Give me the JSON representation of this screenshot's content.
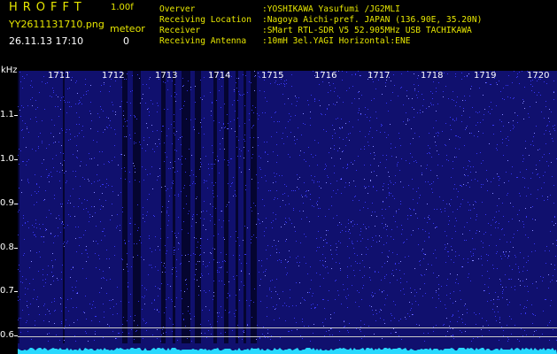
{
  "header": {
    "app_name": "HROFFT",
    "version": "1.00f",
    "file_name": "YY2611131710.png",
    "timestamp": "26.11.13 17:10",
    "meteor_label": "meteor",
    "meteor_count": "0"
  },
  "info": [
    {
      "label": "Overver",
      "value": ":YOSHIKAWA Yasufumi /JG2MLI"
    },
    {
      "label": "Receiving Location",
      "value": ":Nagoya Aichi-pref. JAPAN (136.90E, 35.20N)"
    },
    {
      "label": "Receiver",
      "value": ":SMart RTL-SDR V5 52.905MHz USB TACHIKAWA"
    },
    {
      "label": "Receiving Antenna",
      "value": ":10mH 3el.YAGI Horizontal:ENE"
    }
  ],
  "y_unit": "kHz",
  "y_ticks": [
    "1.1",
    "1.0",
    "0.9",
    "0.8",
    "0.7",
    "0.6"
  ],
  "x_ticks": [
    "1711",
    "1712",
    "1713",
    "1714",
    "1715",
    "1716",
    "1717",
    "1718",
    "1719",
    "1720"
  ],
  "colors": {
    "background": "#000000",
    "header_text": "#e6e600",
    "spectrum_base": "#10106e",
    "spectrum_noise": "#3b3bff",
    "spectrum_trace": "#29d9ff",
    "marker_line": "#c8c8c8"
  }
}
